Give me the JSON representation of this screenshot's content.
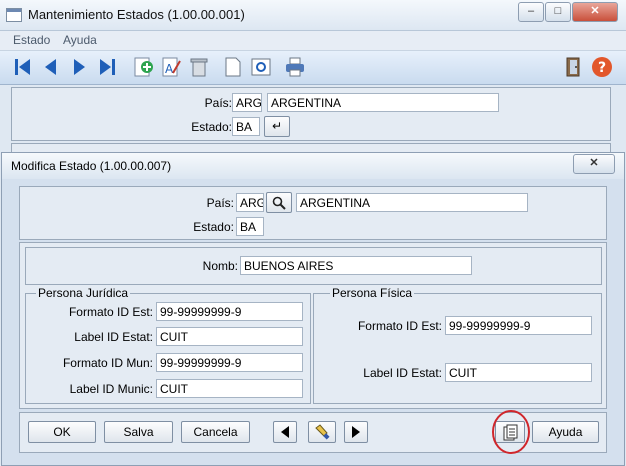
{
  "main_window": {
    "title": "Mantenimiento Estados (1.00.00.001)",
    "minimize": "–",
    "maximize": "□",
    "close": "✕",
    "menu": [
      "Estado",
      "Ayuda"
    ],
    "pais_label": "País:",
    "pais_code": "ARG",
    "pais_name": "ARGENTINA",
    "estado_label": "Estado:",
    "estado_code": "BA",
    "enter_icon": "↵"
  },
  "dialog": {
    "title": "Modifica Estado (1.00.00.007)",
    "close": "✕",
    "pais_label": "País:",
    "pais_code": "ARG",
    "pais_name": "ARGENTINA",
    "estado_label": "Estado:",
    "estado_code": "BA",
    "nomb_label": "Nomb:",
    "nomb_value": "BUENOS AIRES",
    "juridica": {
      "legend": "Persona Jurídica",
      "formato_id_est_label": "Formato ID Est:",
      "formato_id_est": "99-99999999-9",
      "label_id_estat_label": "Label ID Estat:",
      "label_id_estat": "CUIT",
      "formato_id_mun_label": "Formato ID Mun:",
      "formato_id_mun": "99-99999999-9",
      "label_id_munic_label": "Label ID Munic:",
      "label_id_munic": "CUIT"
    },
    "fisica": {
      "legend": "Persona Física",
      "formato_id_est_label": "Formato ID Est:",
      "formato_id_est": "99-99999999-9",
      "label_id_estat_label": "Label ID Estat:",
      "label_id_estat": "CUIT"
    },
    "buttons": {
      "ok": "OK",
      "salva": "Salva",
      "cancela": "Cancela",
      "ayuda": "Ayuda"
    }
  },
  "colors": {
    "highlight_circle": "#d0262b",
    "toolbar_icon": "#1f5fb8"
  }
}
